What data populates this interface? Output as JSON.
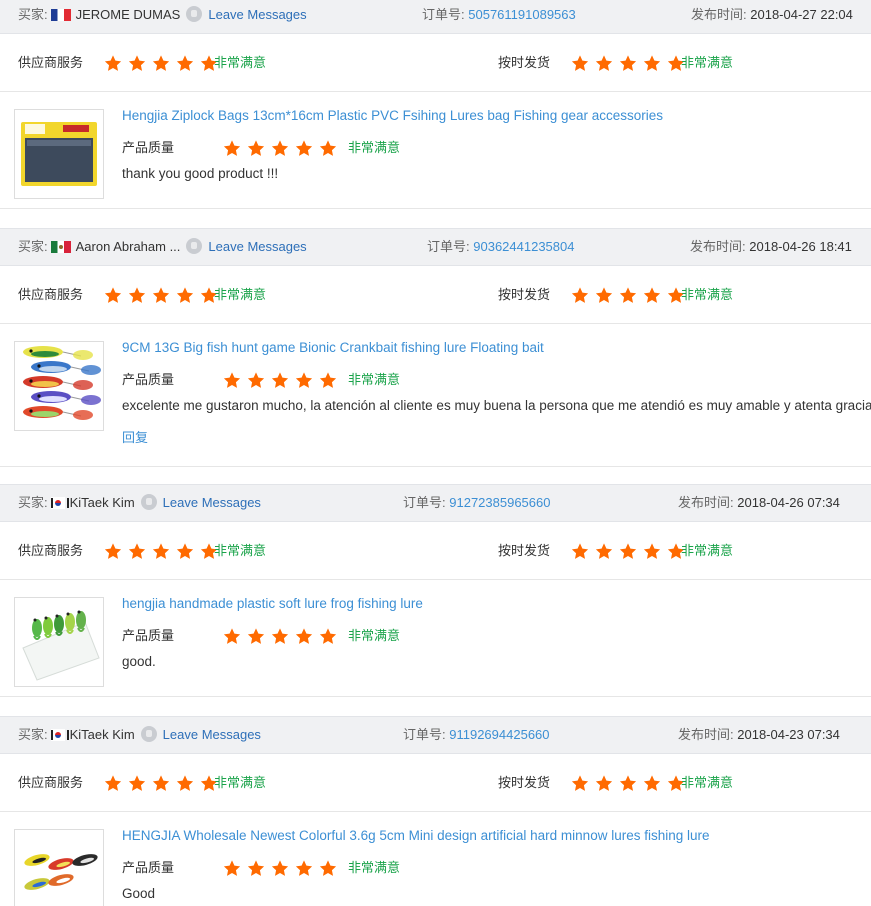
{
  "labels": {
    "buyer": "买家:",
    "leave_messages": "Leave Messages",
    "order_no": "订单号:",
    "published": "发布时间:",
    "supplier_service": "供应商服务",
    "ontime_shipping": "按时发货",
    "product_quality": "产品质量",
    "very_satisfied": "非常满意",
    "reply": "回复"
  },
  "colors": {
    "star": "#ff6a00",
    "link": "#2d6fb8",
    "satisfied": "#1aa34a",
    "header_bg": "#f0f1f3"
  },
  "reviews": [
    {
      "buyer": "JEROME DUMAS",
      "flag": "france-flag",
      "order_no": "505761191089563",
      "time": "2018-04-27 22:04",
      "supplier_stars": 5,
      "shipping_stars": 5,
      "quality_stars": 5,
      "product_title": "Hengjia Ziplock Bags 13cm*16cm Plastic PVC Fsihing Lures bag Fishing gear accessories",
      "comment": "thank you good product !!!",
      "thumb": "ziplock-bag-thumbnail"
    },
    {
      "buyer": "Aaron Abraham ...",
      "flag": "mexico-flag",
      "order_no": "90362441235804",
      "time": "2018-04-26 18:41",
      "supplier_stars": 5,
      "shipping_stars": 5,
      "quality_stars": 5,
      "product_title": "9CM 13G Big fish hunt game Bionic Crankbait fishing lure Floating bait",
      "comment": "excelente me gustaron mucho, la atención al cliente es muy buena la persona que me atendió es muy amable y atenta gracias",
      "has_reply": true,
      "thumb": "crankbait-lures-thumbnail"
    },
    {
      "buyer": "KiTaek Kim",
      "flag": "south-korea-flag",
      "order_no": "91272385965660",
      "time": "2018-04-26 07:34",
      "supplier_stars": 5,
      "shipping_stars": 5,
      "quality_stars": 5,
      "product_title": "hengjia handmade plastic soft lure frog fishing lure",
      "comment": "good.",
      "thumb": "frog-lures-thumbnail"
    },
    {
      "buyer": "KiTaek Kim",
      "flag": "south-korea-flag",
      "order_no": "91192694425660",
      "time": "2018-04-23 07:34",
      "supplier_stars": 5,
      "shipping_stars": 5,
      "quality_stars": 5,
      "product_title": "HENGJIA Wholesale Newest Colorful 3.6g 5cm Mini design artificial hard minnow lures fishing lure",
      "comment": "Good",
      "thumb": "minnow-lures-thumbnail"
    }
  ]
}
